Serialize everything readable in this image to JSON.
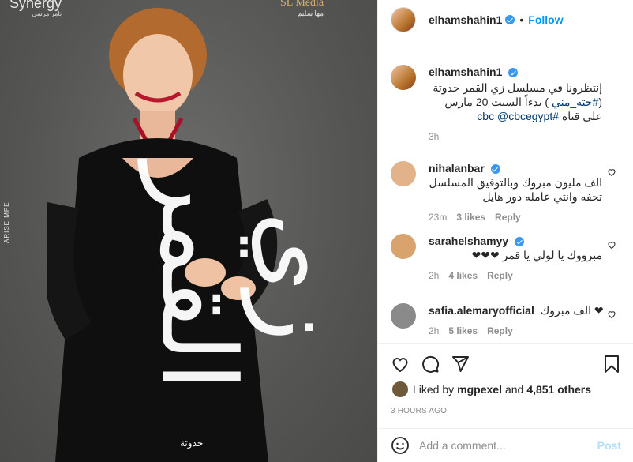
{
  "media": {
    "watermark_left": "Synergy",
    "watermark_left_sub": "تامر مرسي",
    "watermark_right": "SL Media",
    "watermark_right_sub": "مها سليم",
    "side_credit": "ARISE MPE",
    "poster_title": "زي القمر",
    "poster_subtitle": "حدوتة"
  },
  "header": {
    "username": "elhamshahin1",
    "separator": "•",
    "follow_label": "Follow"
  },
  "caption": {
    "username": "elhamshahin1",
    "text_part1": "إنتظرونا في مسلسل زي القمر حدوتة (",
    "hashtag": "#حته_مني",
    "text_part2": " ) بدءاً السبت 20 مارس على قناة ",
    "channel_tag": "#cbc",
    "mention": "@cbcegypt",
    "time": "3h"
  },
  "comments": [
    {
      "username": "nihalanbar",
      "text": "الف مليون مبروك وبالتوفيق المسلسل تحفه وانتي عامله دور هايل",
      "time": "23m",
      "likes": "3 likes",
      "reply": "Reply",
      "avatar_color": "#e2b28a"
    },
    {
      "username": "sarahelshamyy",
      "text": "مبرووك يا لولي يا قمر ❤❤❤",
      "time": "2h",
      "likes": "4 likes",
      "reply": "Reply",
      "avatar_color": "#d9a36d"
    },
    {
      "username": "safia.alemaryofficial",
      "text": "الف مبروك ❤",
      "time": "2h",
      "likes": "5 likes",
      "reply": "Reply",
      "avatar_color": "#8a8a8a"
    }
  ],
  "likes": {
    "prefix": "Liked by",
    "user": "mgpexel",
    "connector": "and",
    "others": "4,851 others"
  },
  "timestamp": "3 HOURS AGO",
  "composer": {
    "placeholder": "Add a comment...",
    "post_label": "Post"
  },
  "colors": {
    "accent": "#0095f6",
    "verified": "#3897f0",
    "muted": "#8e8e8e",
    "post_disabled": "#b2dffc"
  }
}
